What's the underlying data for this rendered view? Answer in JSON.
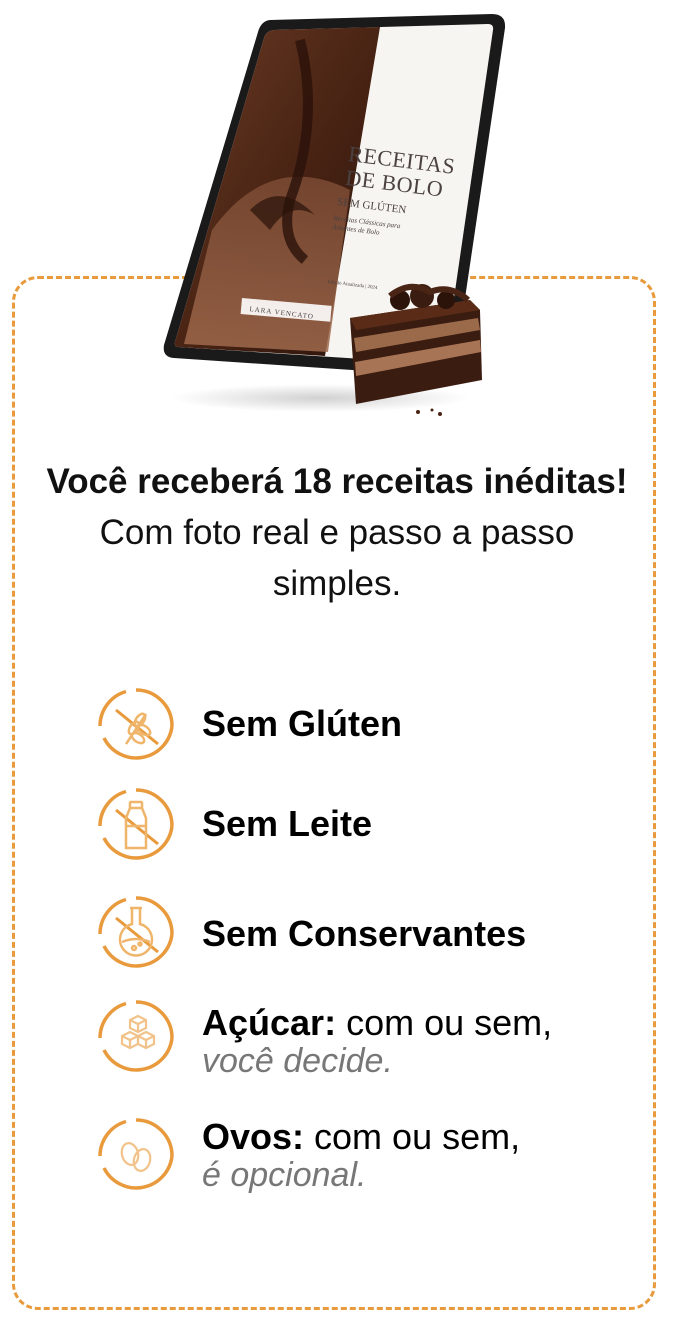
{
  "product": {
    "cover_title": "RECEITAS DE BOLO",
    "cover_subtitle": "SEM GLÚTEN",
    "cover_description": "Receitas Clássicas para Amantes de Bolo",
    "cover_author": "LARA VENCATO",
    "cover_edition": "Edição Atualizada | 2024"
  },
  "headline": {
    "bold": "Você receberá 18 receitas inéditas!",
    "regular": " Com foto real e passo a passo simples."
  },
  "features": [
    {
      "icon": "wheat-icon",
      "title": "Sem Glúten",
      "detail": "",
      "note": ""
    },
    {
      "icon": "milk-bottle-icon",
      "title": "Sem Leite",
      "detail": "",
      "note": ""
    },
    {
      "icon": "flask-icon",
      "title": "Sem Conservantes",
      "detail": "",
      "note": ""
    },
    {
      "icon": "sugar-cubes-icon",
      "title": "Açúcar:",
      "detail": " com ou sem,",
      "note": "você decide."
    },
    {
      "icon": "eggs-icon",
      "title": "Ovos:",
      "detail": " com ou sem,",
      "note": "é opcional."
    }
  ],
  "colors": {
    "accent": "#e89a3c",
    "text": "#000000",
    "muted": "#777777"
  }
}
